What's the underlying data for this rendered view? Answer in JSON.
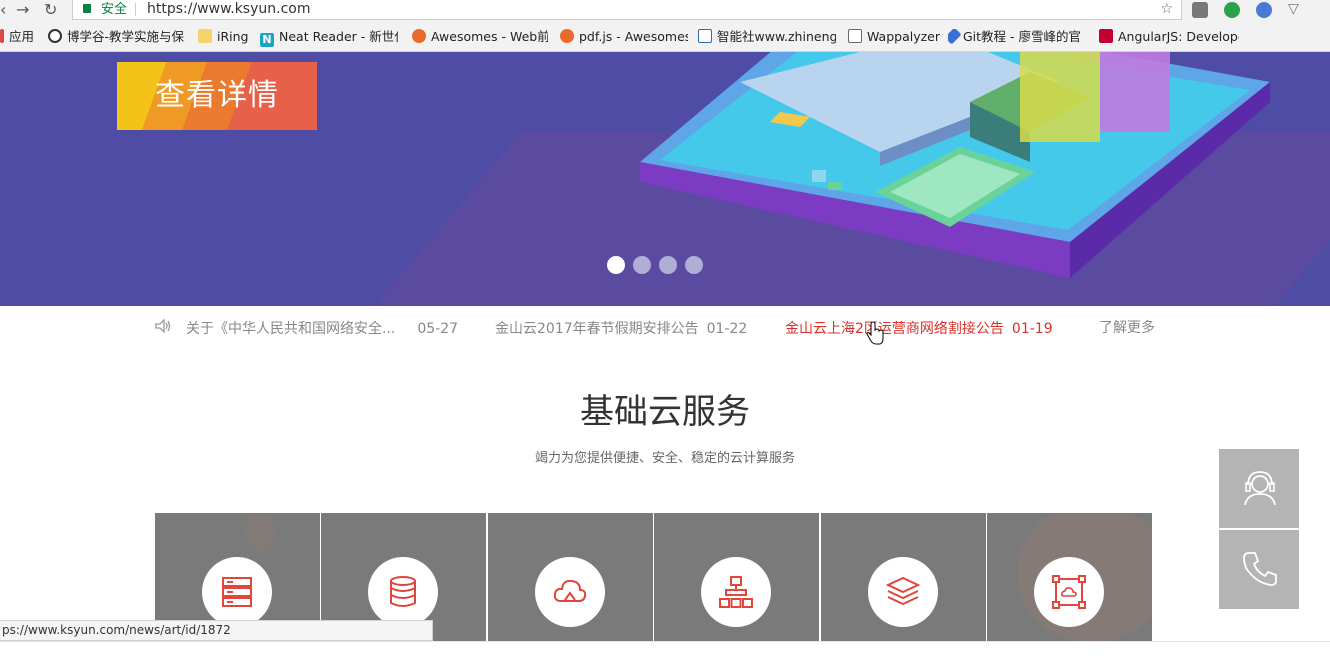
{
  "browser": {
    "secure_label": "安全",
    "url": "https://www.ksyun.com",
    "bookmarks": [
      {
        "label": "应用",
        "icon": "apps-icon"
      },
      {
        "label": "博学谷-教学实施与保",
        "icon": "site-icon"
      },
      {
        "label": "iRing",
        "icon": "folder-icon"
      },
      {
        "label": "Neat Reader - 新世代",
        "icon": "neat-reader-icon"
      },
      {
        "label": "Awesomes - Web前",
        "icon": "awesomes-icon"
      },
      {
        "label": "pdf.js - Awesomes",
        "icon": "awesomes-icon"
      },
      {
        "label": "智能社www.zhinengs",
        "icon": "zhinengshe-icon"
      },
      {
        "label": "Wappalyzer",
        "icon": "page-icon"
      },
      {
        "label": "Git教程 - 廖雪峰的官",
        "icon": "rocket-icon"
      },
      {
        "label": "AngularJS: Develope",
        "icon": "angular-icon"
      }
    ],
    "status_url": "ps://www.ksyun.com/news/art/id/1872"
  },
  "hero": {
    "detail_button": "查看详情",
    "slides_count": 4,
    "active_slide": 1
  },
  "news": {
    "items": [
      {
        "title": "关于《中华人民共和国网络安全...",
        "date": "05-27"
      },
      {
        "title": "金山云2017年春节假期安排公告",
        "date": "01-22"
      },
      {
        "title": "金山云上海2区运营商网络割接公告",
        "date": "01-19"
      }
    ],
    "more_label": "了解更多"
  },
  "section": {
    "title": "基础云服务",
    "subtitle": "竭力为您提供便捷、安全、稳定的云计算服务"
  },
  "services": [
    {
      "icon": "server-icon"
    },
    {
      "icon": "database-icon"
    },
    {
      "icon": "cloud-storage-icon"
    },
    {
      "icon": "network-icon"
    },
    {
      "icon": "layers-icon"
    },
    {
      "icon": "cloud-frame-icon"
    }
  ],
  "colors": {
    "hero_bg": "#4e4ca4",
    "accent_red": "#d9302c",
    "card_bg": "#7a7a7a",
    "icon_red": "#e0463a"
  }
}
